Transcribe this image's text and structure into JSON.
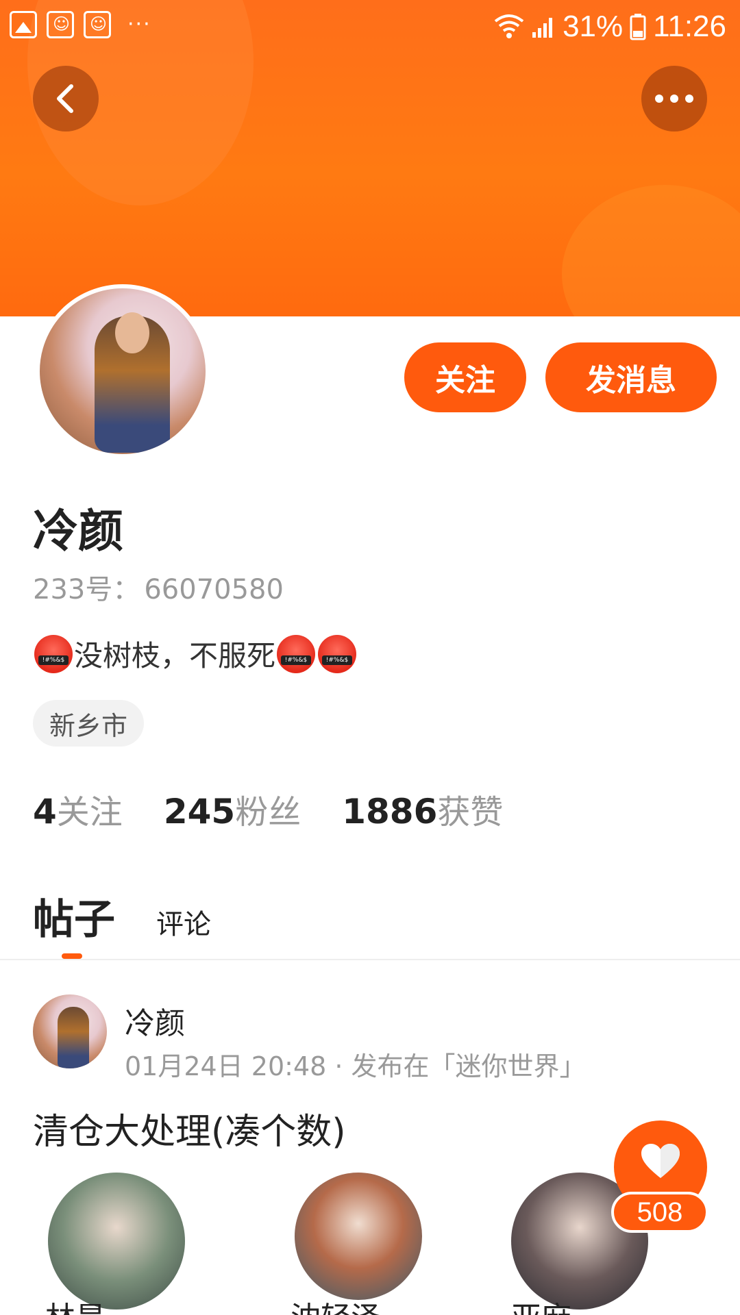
{
  "status_bar": {
    "battery": "31%",
    "time": "11:26",
    "dots": "···"
  },
  "profile": {
    "name": "冷颜",
    "id_label": "233号：",
    "id_value": "66070580",
    "bio_text": "没树枝，不服死",
    "location": "新乡市",
    "follow_button": "关注",
    "message_button": "发消息",
    "stats": [
      {
        "num": "4",
        "label": "关注"
      },
      {
        "num": "245",
        "label": "粉丝"
      },
      {
        "num": "1886",
        "label": "获赞"
      }
    ]
  },
  "tabs": [
    {
      "label": "帖子",
      "active": true
    },
    {
      "label": "评论",
      "active": false
    }
  ],
  "post": {
    "author": "冷颜",
    "meta": "01月24日 20:48 · 发布在「迷你世界」",
    "title": "清仓大处理(凑个数)",
    "thumbs": [
      {
        "name": "林昊"
      },
      {
        "name": "沈轻泽"
      },
      {
        "name": "亚麻"
      }
    ]
  },
  "like": {
    "count": "508"
  },
  "colors": {
    "accent": "#ff5a0d",
    "banner": "#ff7a12"
  },
  "icons": [
    "back-icon",
    "more-icon",
    "heart-icon",
    "wifi-icon",
    "signal-icon",
    "battery-icon",
    "gallery-icon",
    "baidu-icon"
  ]
}
